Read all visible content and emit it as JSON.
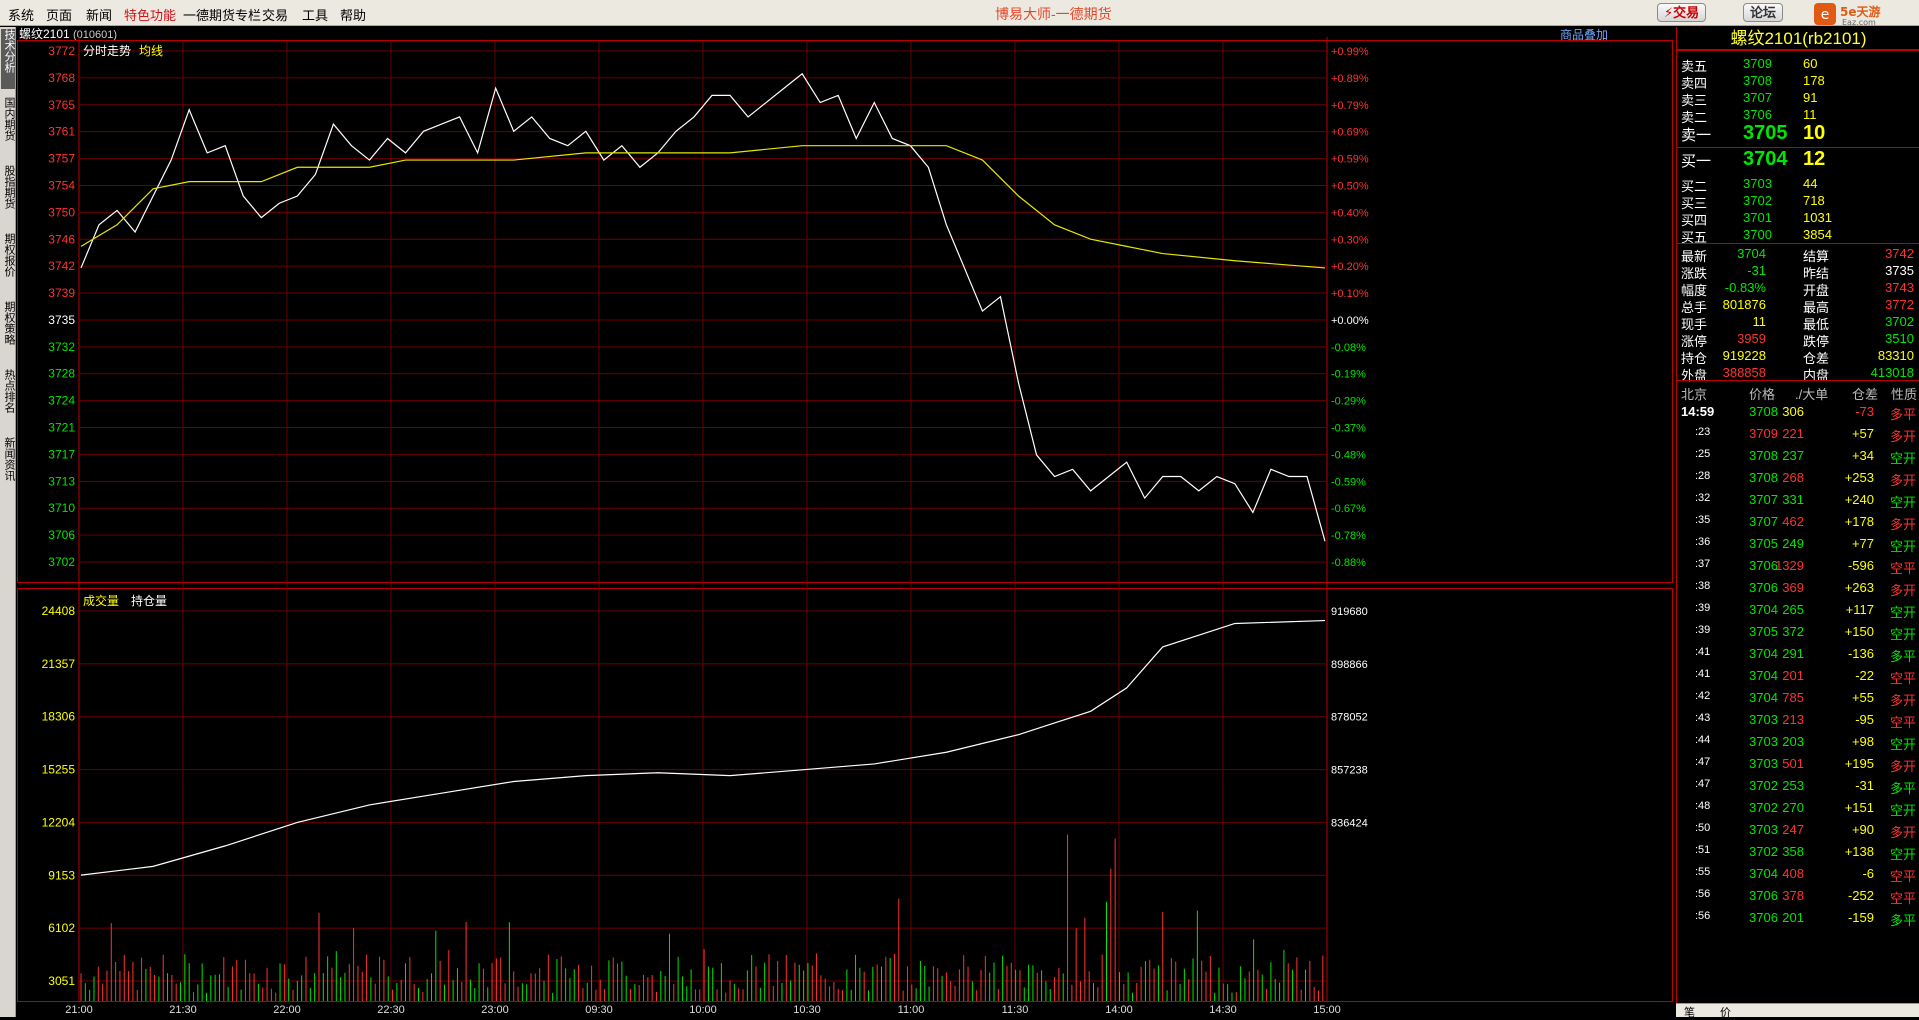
{
  "menu": {
    "items": [
      {
        "label": "系统"
      },
      {
        "label": "页面"
      },
      {
        "label": "新闻"
      },
      {
        "label": "特色功能",
        "active": true
      },
      {
        "label": "一德期货专栏"
      },
      {
        "label": "交易"
      },
      {
        "label": "工具"
      },
      {
        "label": "帮助"
      }
    ]
  },
  "app_title": "博易大师-一德期货",
  "toolbar": {
    "trade": "⚡交易",
    "forum": "论坛"
  },
  "logo_text": "5e天游 Eaz.com",
  "left_tabs": [
    {
      "label": "技术分析",
      "sel": true
    },
    {
      "label": "国内期货"
    },
    {
      "label": "股指期货"
    },
    {
      "label": "期权报价"
    },
    {
      "label": "期权策略"
    },
    {
      "label": "热点排名"
    },
    {
      "label": "新闻资讯"
    }
  ],
  "chart_header": {
    "symbol": "螺纹2101",
    "code": "(010601)",
    "overlay_link": "商品叠加"
  },
  "price_panel": {
    "label": "分时走势",
    "avg_label": "均线"
  },
  "volume_panel": {
    "vol_label": "成交量",
    "oi_label": "持仓量"
  },
  "chart_data": [
    {
      "type": "line",
      "title": "分时走势",
      "series": [
        {
          "name": "分时走势",
          "color": "#ffffff",
          "x": [
            0,
            5,
            10,
            15,
            20,
            25,
            30,
            35,
            40,
            45,
            50,
            55,
            60,
            65,
            70,
            75,
            80,
            85,
            90,
            95,
            100,
            105,
            110,
            115,
            120,
            125,
            130,
            135,
            140,
            145,
            150,
            155,
            160,
            165,
            170,
            175,
            180,
            185,
            190,
            195,
            200,
            205,
            210,
            215,
            220,
            225,
            230,
            235,
            240,
            245,
            250,
            255,
            260,
            265,
            270,
            275,
            280,
            285,
            290,
            295,
            300,
            305,
            310,
            315,
            320,
            325,
            330,
            335,
            340,
            345
          ],
          "y": [
            3742,
            3748,
            3750,
            3747,
            3752,
            3757,
            3764,
            3758,
            3759,
            3752,
            3749,
            3751,
            3752,
            3755,
            3762,
            3759,
            3757,
            3760,
            3758,
            3761,
            3762,
            3763,
            3758,
            3767,
            3761,
            3763,
            3760,
            3759,
            3761,
            3757,
            3759,
            3756,
            3758,
            3761,
            3763,
            3766,
            3766,
            3763,
            3765,
            3767,
            3769,
            3765,
            3766,
            3760,
            3765,
            3760,
            3759,
            3756,
            3748,
            3742,
            3736,
            3738,
            3726,
            3716,
            3713,
            3714,
            3711,
            3713,
            3715,
            3710,
            3713,
            3713,
            3711,
            3713,
            3712,
            3708,
            3714,
            3713,
            3713,
            3704
          ]
        },
        {
          "name": "均线",
          "color": "#e6e600",
          "x": [
            0,
            10,
            20,
            30,
            40,
            50,
            60,
            70,
            80,
            90,
            100,
            120,
            140,
            160,
            180,
            200,
            220,
            240,
            250,
            260,
            270,
            280,
            290,
            300,
            320,
            345
          ],
          "y": [
            3745,
            3748,
            3753,
            3754,
            3754,
            3754,
            3756,
            3756,
            3756,
            3757,
            3757,
            3757,
            3758,
            3758,
            3758,
            3759,
            3759,
            3759,
            3757,
            3752,
            3748,
            3746,
            3745,
            3744,
            3743,
            3742
          ]
        }
      ],
      "y_ticks": [
        "3772",
        "3768",
        "3765",
        "3761",
        "3757",
        "3754",
        "3750",
        "3746",
        "3742",
        "3739",
        "3735",
        "3732",
        "3728",
        "3724",
        "3721",
        "3717",
        "3713",
        "3710",
        "3706",
        "3702"
      ],
      "y2_ticks": [
        "+0.99%",
        "+0.89%",
        "+0.79%",
        "+0.69%",
        "+0.59%",
        "+0.50%",
        "+0.40%",
        "+0.30%",
        "+0.20%",
        "+0.10%",
        "+0.00%",
        "-0.08%",
        "-0.19%",
        "-0.29%",
        "-0.37%",
        "-0.48%",
        "-0.59%",
        "-0.67%",
        "-0.78%",
        "-0.88%"
      ],
      "ylim": [
        3700,
        3773
      ]
    },
    {
      "type": "bar",
      "title": "成交量",
      "y_ticks": [
        "24408",
        "21357",
        "18306",
        "15255",
        "12204",
        "9153",
        "6102",
        "3051"
      ],
      "y2_ticks": [
        "919680",
        "898866",
        "878052",
        "857238",
        "836424"
      ],
      "series": [
        {
          "name": "持仓量",
          "color": "#ffffff",
          "x": [
            0,
            20,
            40,
            60,
            80,
            100,
            120,
            140,
            160,
            180,
            200,
            220,
            240,
            260,
            270,
            280,
            290,
            300,
            320,
            345
          ],
          "y": [
            832000,
            835000,
            842000,
            850000,
            856000,
            860000,
            864000,
            866000,
            867000,
            866000,
            868000,
            870000,
            874000,
            880000,
            884000,
            888000,
            896000,
            910000,
            918000,
            919000
          ]
        }
      ],
      "x_ticks": [
        "21:00",
        "21:30",
        "22:00",
        "22:30",
        "23:00",
        "09:30",
        "10:00",
        "10:30",
        "11:00",
        "11:30",
        "14:00",
        "14:30",
        "15:00"
      ]
    }
  ],
  "quote": {
    "title": "螺纹2101(rb2101)",
    "asks": [
      {
        "label": "卖五",
        "price": "3709",
        "vol": "60"
      },
      {
        "label": "卖四",
        "price": "3708",
        "vol": "178"
      },
      {
        "label": "卖三",
        "price": "3707",
        "vol": "91"
      },
      {
        "label": "卖二",
        "price": "3706",
        "vol": "11"
      },
      {
        "label": "卖一",
        "price": "3705",
        "vol": "10"
      }
    ],
    "bids": [
      {
        "label": "买一",
        "price": "3704",
        "vol": "12"
      },
      {
        "label": "买二",
        "price": "3703",
        "vol": "44"
      },
      {
        "label": "买三",
        "price": "3702",
        "vol": "718"
      },
      {
        "label": "买四",
        "price": "3701",
        "vol": "1031"
      },
      {
        "label": "买五",
        "price": "3700",
        "vol": "3854"
      }
    ],
    "stats": [
      {
        "l1": "最新",
        "v1": "3704",
        "c1": "g",
        "l2": "结算",
        "v2": "3742",
        "c2": "r"
      },
      {
        "l1": "涨跌",
        "v1": "-31",
        "c1": "g",
        "l2": "昨结",
        "v2": "3735",
        "c2": "w"
      },
      {
        "l1": "幅度",
        "v1": "-0.83%",
        "c1": "g",
        "l2": "开盘",
        "v2": "3743",
        "c2": "r"
      },
      {
        "l1": "总手",
        "v1": "801876",
        "c1": "y",
        "l2": "最高",
        "v2": "3772",
        "c2": "r"
      },
      {
        "l1": "现手",
        "v1": "11",
        "c1": "y",
        "l2": "最低",
        "v2": "3702",
        "c2": "g"
      },
      {
        "l1": "涨停",
        "v1": "3959",
        "c1": "r",
        "l2": "跌停",
        "v2": "3510",
        "c2": "g"
      },
      {
        "l1": "持仓",
        "v1": "919228",
        "c1": "y",
        "l2": "仓差",
        "v2": "83310",
        "c2": "y"
      },
      {
        "l1": "外盘",
        "v1": "388858",
        "c1": "r",
        "l2": "内盘",
        "v2": "413018",
        "c2": "g"
      }
    ]
  },
  "ticker": {
    "headers": [
      "北京",
      "价格",
      "./大单",
      "仓差",
      "性质"
    ],
    "rows": [
      {
        "t": "14:59",
        "p": "3708",
        "pc": "g",
        "v": "306",
        "vc": "y",
        "d": "-73",
        "dc": "r",
        "n": "多平",
        "nc": "r"
      },
      {
        "t": ":23",
        "p": "3709",
        "pc": "r",
        "v": "221",
        "vc": "r",
        "d": "+57",
        "dc": "y",
        "n": "多开",
        "nc": "r"
      },
      {
        "t": ":25",
        "p": "3708",
        "pc": "g",
        "v": "237",
        "vc": "g",
        "d": "+34",
        "dc": "y",
        "n": "空开",
        "nc": "g"
      },
      {
        "t": ":28",
        "p": "3708",
        "pc": "g",
        "v": "268",
        "vc": "r",
        "d": "+253",
        "dc": "y",
        "n": "多开",
        "nc": "r"
      },
      {
        "t": ":32",
        "p": "3707",
        "pc": "g",
        "v": "331",
        "vc": "g",
        "d": "+240",
        "dc": "y",
        "n": "空开",
        "nc": "g"
      },
      {
        "t": ":35",
        "p": "3707",
        "pc": "g",
        "v": "462",
        "vc": "r",
        "d": "+178",
        "dc": "y",
        "n": "多开",
        "nc": "r"
      },
      {
        "t": ":36",
        "p": "3705",
        "pc": "g",
        "v": "249",
        "vc": "g",
        "d": "+77",
        "dc": "y",
        "n": "空开",
        "nc": "g"
      },
      {
        "t": ":37",
        "p": "3706",
        "pc": "g",
        "v": "1329",
        "vc": "r",
        "d": "-596",
        "dc": "y",
        "n": "空平",
        "nc": "r"
      },
      {
        "t": ":38",
        "p": "3706",
        "pc": "g",
        "v": "369",
        "vc": "r",
        "d": "+263",
        "dc": "y",
        "n": "多开",
        "nc": "r"
      },
      {
        "t": ":39",
        "p": "3704",
        "pc": "g",
        "v": "265",
        "vc": "g",
        "d": "+117",
        "dc": "y",
        "n": "空开",
        "nc": "g"
      },
      {
        "t": ":39",
        "p": "3705",
        "pc": "g",
        "v": "372",
        "vc": "g",
        "d": "+150",
        "dc": "y",
        "n": "空开",
        "nc": "g"
      },
      {
        "t": ":41",
        "p": "3704",
        "pc": "g",
        "v": "291",
        "vc": "g",
        "d": "-136",
        "dc": "y",
        "n": "多平",
        "nc": "g"
      },
      {
        "t": ":41",
        "p": "3704",
        "pc": "g",
        "v": "201",
        "vc": "r",
        "d": "-22",
        "dc": "y",
        "n": "空平",
        "nc": "r"
      },
      {
        "t": ":42",
        "p": "3704",
        "pc": "g",
        "v": "785",
        "vc": "r",
        "d": "+55",
        "dc": "y",
        "n": "多开",
        "nc": "r"
      },
      {
        "t": ":43",
        "p": "3703",
        "pc": "g",
        "v": "213",
        "vc": "r",
        "d": "-95",
        "dc": "y",
        "n": "空平",
        "nc": "r"
      },
      {
        "t": ":44",
        "p": "3703",
        "pc": "g",
        "v": "203",
        "vc": "g",
        "d": "+98",
        "dc": "y",
        "n": "空开",
        "nc": "g"
      },
      {
        "t": ":47",
        "p": "3703",
        "pc": "g",
        "v": "501",
        "vc": "r",
        "d": "+195",
        "dc": "y",
        "n": "多开",
        "nc": "r"
      },
      {
        "t": ":47",
        "p": "3702",
        "pc": "g",
        "v": "253",
        "vc": "g",
        "d": "-31",
        "dc": "y",
        "n": "多平",
        "nc": "g"
      },
      {
        "t": ":48",
        "p": "3702",
        "pc": "g",
        "v": "270",
        "vc": "g",
        "d": "+151",
        "dc": "y",
        "n": "空开",
        "nc": "g"
      },
      {
        "t": ":50",
        "p": "3703",
        "pc": "g",
        "v": "247",
        "vc": "r",
        "d": "+90",
        "dc": "y",
        "n": "多开",
        "nc": "r"
      },
      {
        "t": ":51",
        "p": "3702",
        "pc": "g",
        "v": "358",
        "vc": "g",
        "d": "+138",
        "dc": "y",
        "n": "空开",
        "nc": "g"
      },
      {
        "t": ":55",
        "p": "3704",
        "pc": "g",
        "v": "408",
        "vc": "r",
        "d": "-6",
        "dc": "y",
        "n": "空平",
        "nc": "r"
      },
      {
        "t": ":56",
        "p": "3706",
        "pc": "g",
        "v": "378",
        "vc": "r",
        "d": "-252",
        "dc": "y",
        "n": "空平",
        "nc": "r"
      },
      {
        "t": ":56",
        "p": "3706",
        "pc": "g",
        "v": "201",
        "vc": "g",
        "d": "-159",
        "dc": "y",
        "n": "多平",
        "nc": "g"
      }
    ]
  },
  "bottom_tabs": [
    "笔",
    "价"
  ]
}
